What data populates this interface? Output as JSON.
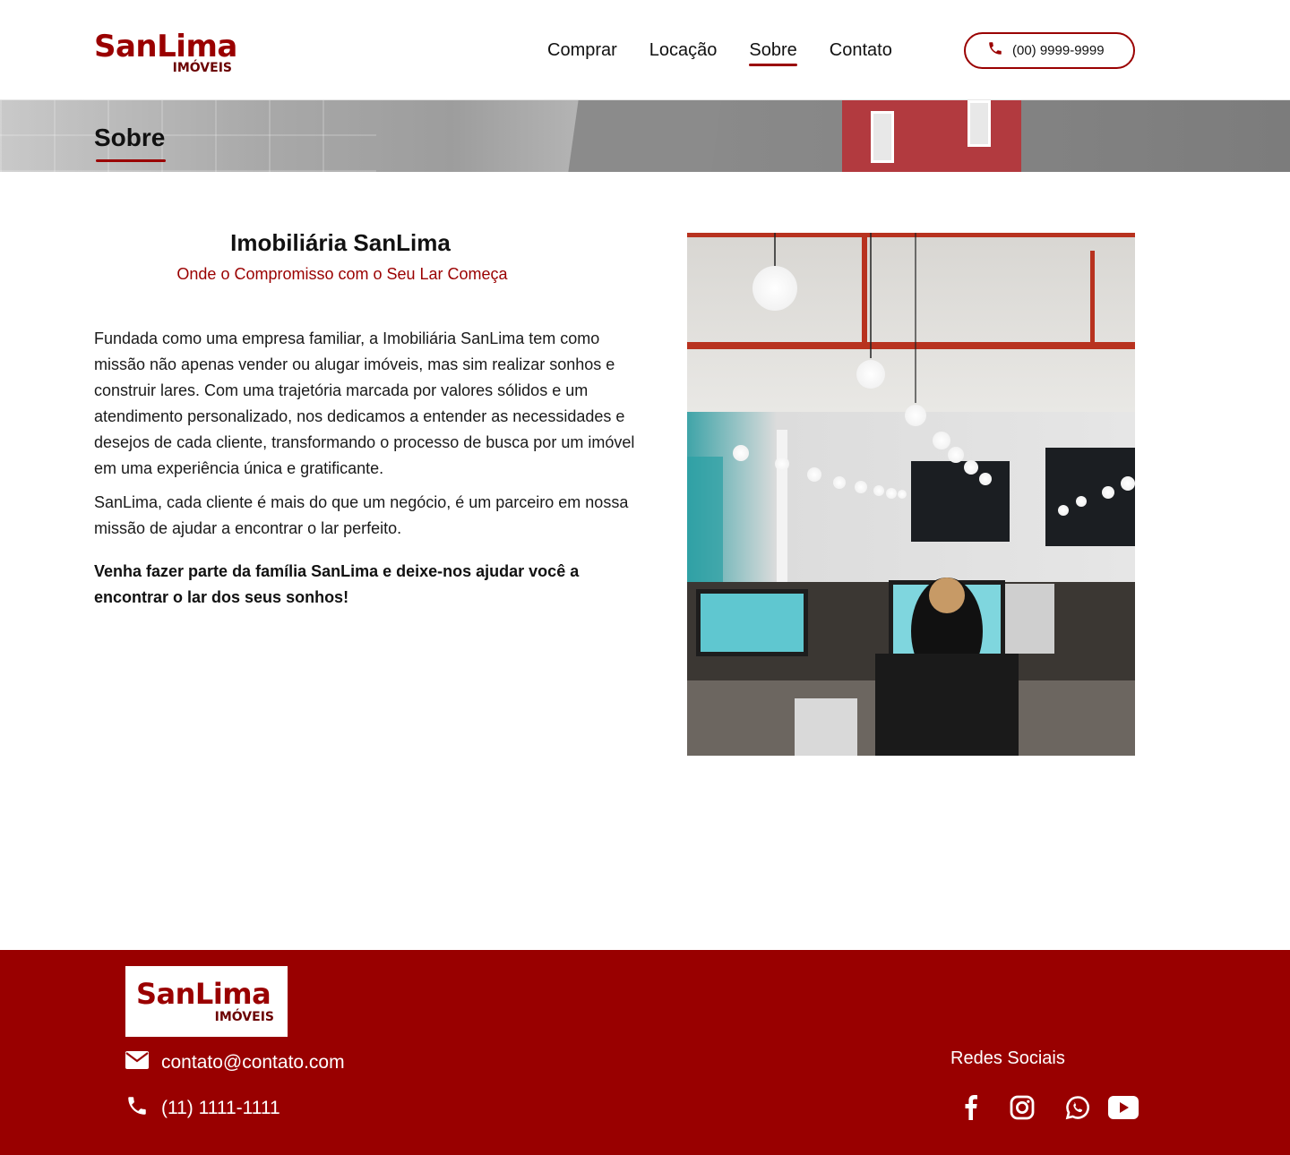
{
  "header": {
    "logo": {
      "brand": "SanLima",
      "sub": "IMÓVEIS"
    },
    "nav": [
      {
        "label": "Comprar"
      },
      {
        "label": "Locação"
      },
      {
        "label": "Sobre",
        "active": true
      },
      {
        "label": "Contato"
      }
    ],
    "phone_button": {
      "label": "(00) 9999-9999",
      "icon": "phone-icon"
    }
  },
  "banner": {
    "title": "Sobre"
  },
  "main": {
    "heading": "Imobiliária SanLima",
    "subheading": "Onde o Compromisso com o Seu Lar Começa",
    "paragraphs": [
      "Fundada como uma empresa familiar, a Imobiliária SanLima tem como missão não apenas vender ou alugar imóveis, mas sim realizar sonhos e construir lares. Com uma trajetória marcada por valores sólidos e um atendimento personalizado, nos dedicamos a entender as necessidades e desejos de cada cliente, transformando o processo de busca por um imóvel em uma experiência única e gratificante.",
      "SanLima, cada cliente é mais do que um negócio, é um parceiro em nossa missão de ajudar a encontrar o lar perfeito.",
      "Venha fazer parte da família SanLima e deixe-nos ajudar você a encontrar o lar dos seus sonhos!"
    ],
    "photo": {
      "icon": "office-photo"
    }
  },
  "footer": {
    "logo": {
      "brand": "SanLima",
      "sub": "IMÓVEIS"
    },
    "email": {
      "label": "contato@contato.com",
      "icon": "envelope-icon"
    },
    "phone": {
      "label": "(11) 1111-1111",
      "icon": "phone-icon"
    },
    "social_title": "Redes Sociais",
    "socials": [
      "facebook-icon",
      "instagram-icon",
      "whatsapp-icon",
      "youtube-icon"
    ]
  },
  "colors": {
    "brand": "#9a0000",
    "footer_bg": "#990000",
    "text": "#111111"
  }
}
